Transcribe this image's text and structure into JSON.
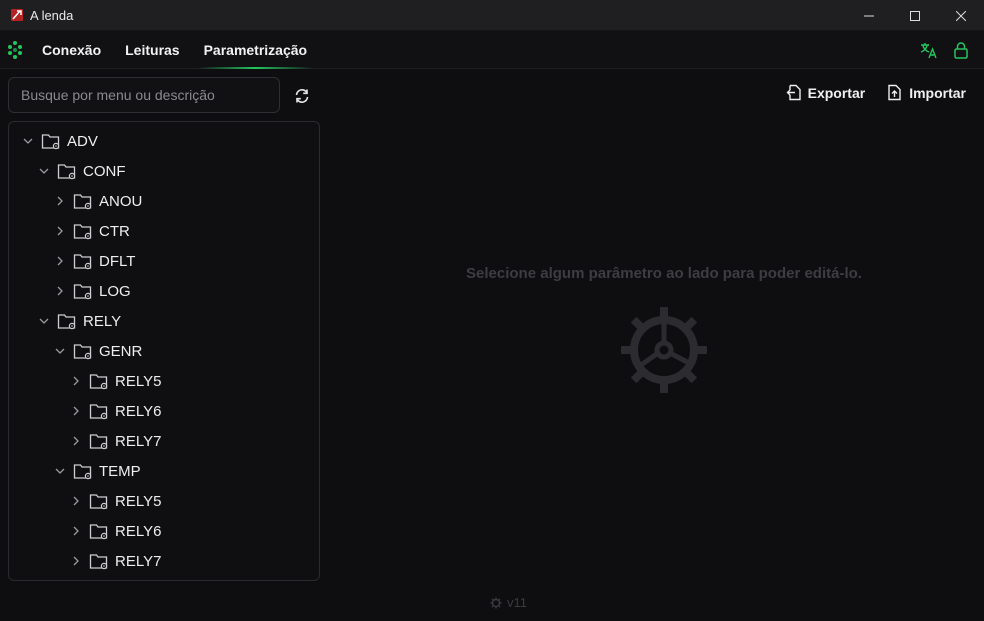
{
  "window": {
    "title": "A lenda"
  },
  "nav": {
    "tabs": [
      {
        "label": "Conexão"
      },
      {
        "label": "Leituras"
      },
      {
        "label": "Parametrização"
      }
    ],
    "accent": "#22c55e"
  },
  "sidebar": {
    "search": {
      "placeholder": "Busque por menu ou descrição",
      "value": ""
    },
    "tree": [
      {
        "label": "ADV",
        "depth": 0,
        "expanded": true
      },
      {
        "label": "CONF",
        "depth": 1,
        "expanded": true
      },
      {
        "label": "ANOU",
        "depth": 2,
        "expanded": false
      },
      {
        "label": "CTR",
        "depth": 2,
        "expanded": false
      },
      {
        "label": "DFLT",
        "depth": 2,
        "expanded": false
      },
      {
        "label": "LOG",
        "depth": 2,
        "expanded": false
      },
      {
        "label": "RELY",
        "depth": 1,
        "expanded": true
      },
      {
        "label": "GENR",
        "depth": 2,
        "expanded": true
      },
      {
        "label": "RELY5",
        "depth": 3,
        "expanded": false
      },
      {
        "label": "RELY6",
        "depth": 3,
        "expanded": false
      },
      {
        "label": "RELY7",
        "depth": 3,
        "expanded": false
      },
      {
        "label": "TEMP",
        "depth": 2,
        "expanded": true
      },
      {
        "label": "RELY5",
        "depth": 3,
        "expanded": false
      },
      {
        "label": "RELY6",
        "depth": 3,
        "expanded": false
      },
      {
        "label": "RELY7",
        "depth": 3,
        "expanded": false
      }
    ]
  },
  "main": {
    "export_label": "Exportar",
    "import_label": "Importar",
    "empty_message": "Selecione algum parâmetro ao lado para poder editá-lo.",
    "version": "v11"
  }
}
